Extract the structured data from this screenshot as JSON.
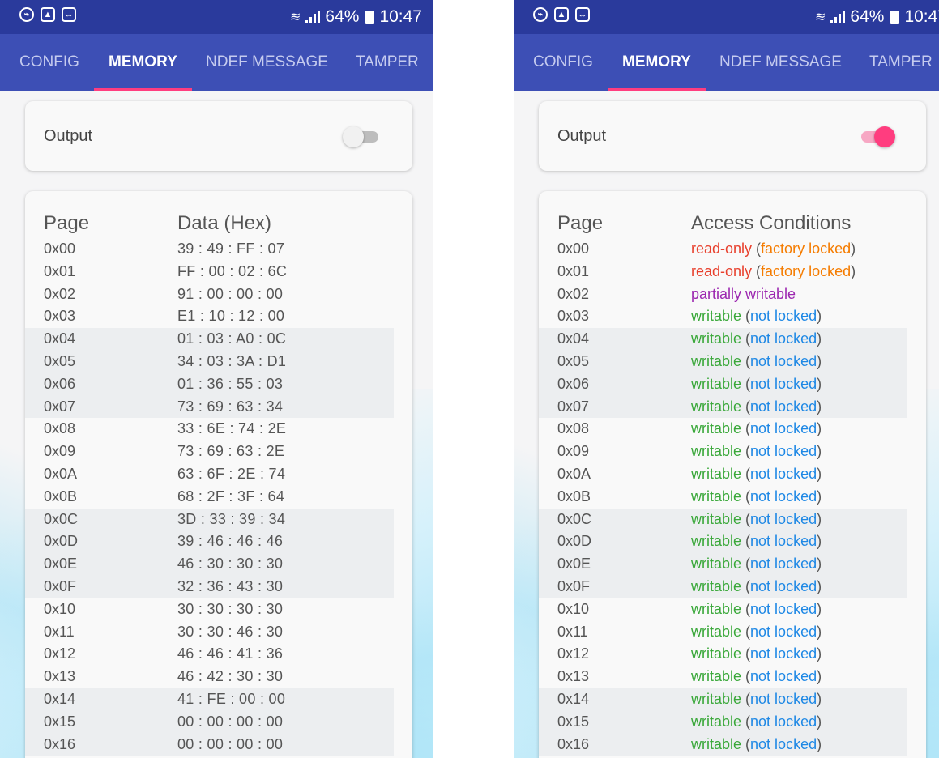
{
  "status_bar": {
    "battery": "64%",
    "time": "10:47",
    "icons": [
      "hotspot-icon",
      "gallery-icon",
      "sync-icon",
      "wifi-icon",
      "signal-icon",
      "battery-icon"
    ]
  },
  "tabs": [
    {
      "label": "CONFIG",
      "active": false
    },
    {
      "label": "MEMORY",
      "active": true
    },
    {
      "label": "NDEF MESSAGE",
      "active": false
    },
    {
      "label": "TAMPER",
      "active": false
    }
  ],
  "colors": {
    "status_bar": "#2a3a9c",
    "app_bar": "#3d4fb5",
    "tab_indicator": "#ff3d7f",
    "toggle_on": "#ff3d7f",
    "read_only": "#e8412e",
    "factory_locked": "#f57c00",
    "partially_writable": "#9c27b0",
    "writable": "#3aa83a",
    "not_locked": "#1e88e5",
    "paren": "#555555"
  },
  "left": {
    "output_label": "Output",
    "output_on": false,
    "col_page": "Page",
    "col_data": "Data (Hex)",
    "rows": [
      {
        "page": "0x00",
        "data": "39 : 49 : FF : 07"
      },
      {
        "page": "0x01",
        "data": "FF : 00 : 02 : 6C"
      },
      {
        "page": "0x02",
        "data": "91 : 00 : 00 : 00"
      },
      {
        "page": "0x03",
        "data": "E1 : 10 : 12 : 00"
      },
      {
        "page": "0x04",
        "data": "01 : 03 : A0 : 0C"
      },
      {
        "page": "0x05",
        "data": "34 : 03 : 3A : D1"
      },
      {
        "page": "0x06",
        "data": "01 : 36 : 55 : 03"
      },
      {
        "page": "0x07",
        "data": "73 : 69 : 63 : 34"
      },
      {
        "page": "0x08",
        "data": "33 : 6E : 74 : 2E"
      },
      {
        "page": "0x09",
        "data": "73 : 69 : 63 : 2E"
      },
      {
        "page": "0x0A",
        "data": "63 : 6F : 2E : 74"
      },
      {
        "page": "0x0B",
        "data": "68 : 2F : 3F : 64"
      },
      {
        "page": "0x0C",
        "data": "3D : 33 : 39 : 34"
      },
      {
        "page": "0x0D",
        "data": "39 : 46 : 46 : 46"
      },
      {
        "page": "0x0E",
        "data": "46 : 30 : 30 : 30"
      },
      {
        "page": "0x0F",
        "data": "32 : 36 : 43 : 30"
      },
      {
        "page": "0x10",
        "data": "30 : 30 : 30 : 30"
      },
      {
        "page": "0x11",
        "data": "30 : 30 : 46 : 30"
      },
      {
        "page": "0x12",
        "data": "46 : 46 : 41 : 36"
      },
      {
        "page": "0x13",
        "data": "46 : 42 : 30 : 30"
      },
      {
        "page": "0x14",
        "data": "41 : FE : 00 : 00"
      },
      {
        "page": "0x15",
        "data": "00 : 00 : 00 : 00"
      },
      {
        "page": "0x16",
        "data": "00 : 00 : 00 : 00"
      }
    ]
  },
  "right": {
    "output_label": "Output",
    "output_on": true,
    "col_page": "Page",
    "col_access": "Access Conditions",
    "rows": [
      {
        "page": "0x00",
        "access": "read-only",
        "access_type": "read_only",
        "lock": "factory locked",
        "lock_type": "factory_locked"
      },
      {
        "page": "0x01",
        "access": "read-only",
        "access_type": "read_only",
        "lock": "factory locked",
        "lock_type": "factory_locked"
      },
      {
        "page": "0x02",
        "access": "partially writable",
        "access_type": "partially_writable",
        "lock": "",
        "lock_type": ""
      },
      {
        "page": "0x03",
        "access": "writable",
        "access_type": "writable",
        "lock": "not locked",
        "lock_type": "not_locked"
      },
      {
        "page": "0x04",
        "access": "writable",
        "access_type": "writable",
        "lock": "not locked",
        "lock_type": "not_locked"
      },
      {
        "page": "0x05",
        "access": "writable",
        "access_type": "writable",
        "lock": "not locked",
        "lock_type": "not_locked"
      },
      {
        "page": "0x06",
        "access": "writable",
        "access_type": "writable",
        "lock": "not locked",
        "lock_type": "not_locked"
      },
      {
        "page": "0x07",
        "access": "writable",
        "access_type": "writable",
        "lock": "not locked",
        "lock_type": "not_locked"
      },
      {
        "page": "0x08",
        "access": "writable",
        "access_type": "writable",
        "lock": "not locked",
        "lock_type": "not_locked"
      },
      {
        "page": "0x09",
        "access": "writable",
        "access_type": "writable",
        "lock": "not locked",
        "lock_type": "not_locked"
      },
      {
        "page": "0x0A",
        "access": "writable",
        "access_type": "writable",
        "lock": "not locked",
        "lock_type": "not_locked"
      },
      {
        "page": "0x0B",
        "access": "writable",
        "access_type": "writable",
        "lock": "not locked",
        "lock_type": "not_locked"
      },
      {
        "page": "0x0C",
        "access": "writable",
        "access_type": "writable",
        "lock": "not locked",
        "lock_type": "not_locked"
      },
      {
        "page": "0x0D",
        "access": "writable",
        "access_type": "writable",
        "lock": "not locked",
        "lock_type": "not_locked"
      },
      {
        "page": "0x0E",
        "access": "writable",
        "access_type": "writable",
        "lock": "not locked",
        "lock_type": "not_locked"
      },
      {
        "page": "0x0F",
        "access": "writable",
        "access_type": "writable",
        "lock": "not locked",
        "lock_type": "not_locked"
      },
      {
        "page": "0x10",
        "access": "writable",
        "access_type": "writable",
        "lock": "not locked",
        "lock_type": "not_locked"
      },
      {
        "page": "0x11",
        "access": "writable",
        "access_type": "writable",
        "lock": "not locked",
        "lock_type": "not_locked"
      },
      {
        "page": "0x12",
        "access": "writable",
        "access_type": "writable",
        "lock": "not locked",
        "lock_type": "not_locked"
      },
      {
        "page": "0x13",
        "access": "writable",
        "access_type": "writable",
        "lock": "not locked",
        "lock_type": "not_locked"
      },
      {
        "page": "0x14",
        "access": "writable",
        "access_type": "writable",
        "lock": "not locked",
        "lock_type": "not_locked"
      },
      {
        "page": "0x15",
        "access": "writable",
        "access_type": "writable",
        "lock": "not locked",
        "lock_type": "not_locked"
      },
      {
        "page": "0x16",
        "access": "writable",
        "access_type": "writable",
        "lock": "not locked",
        "lock_type": "not_locked"
      }
    ]
  }
}
